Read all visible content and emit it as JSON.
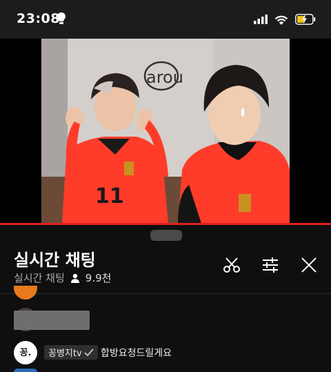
{
  "status_bar": {
    "time": "23:08",
    "battery": "charging"
  },
  "chat": {
    "title": "실시간 채팅",
    "subtitle": "실시간 채팅",
    "viewers": "9.9천"
  },
  "message": {
    "avatar_text": "꽁.",
    "author": "꽁병지tv",
    "text": "합방요청드릴게요"
  },
  "video": {
    "wall_logo": "arou"
  },
  "colors": {
    "accent": "#e02020",
    "jersey": "#ff3c2a",
    "orange_avatar": "#e97a1b"
  },
  "icons": [
    "lightbulb-icon",
    "signal-icon",
    "wifi-icon",
    "battery-icon",
    "people-icon",
    "scissors-icon",
    "sliders-icon",
    "close-icon",
    "verified-check-icon"
  ]
}
